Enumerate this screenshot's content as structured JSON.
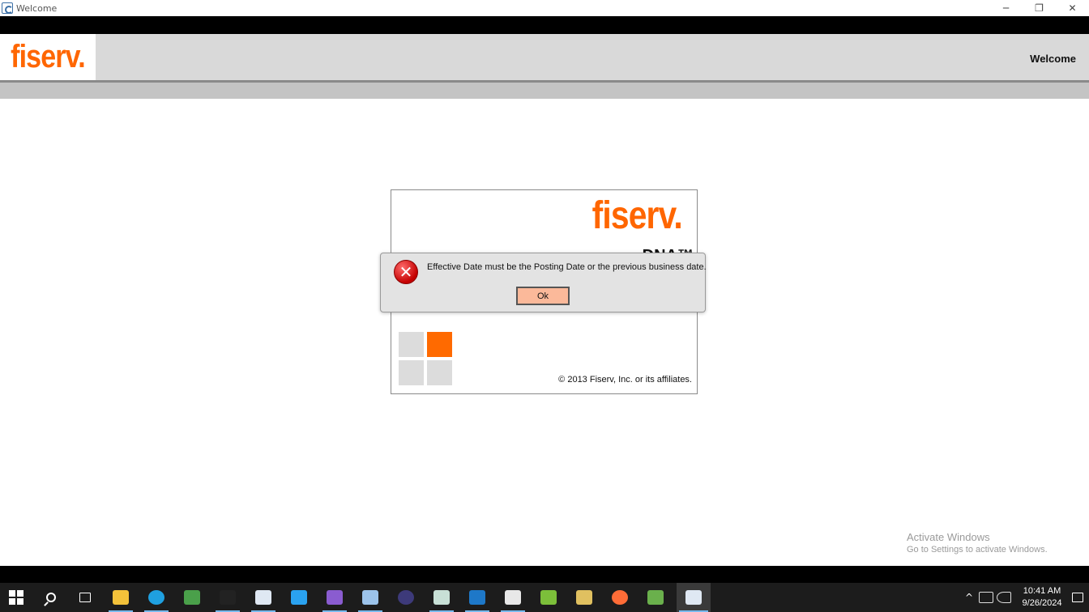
{
  "window": {
    "title": "Welcome",
    "controls": {
      "minimize": "─",
      "restore": "❐",
      "close": "✕"
    }
  },
  "header": {
    "logo": "fiserv.",
    "title": "Welcome"
  },
  "splash": {
    "logo": "fiserv.",
    "product": "DNA™",
    "copyright": "© 2013 Fiserv, Inc. or its affiliates.",
    "brand_color": "#ff6600"
  },
  "dialog": {
    "message": "Effective Date must be the Posting Date or the previous business date.",
    "ok_label": "Ok",
    "icon": "error-icon"
  },
  "watermark": {
    "line1": "Activate Windows",
    "line2": "Go to Settings to activate Windows."
  },
  "taskbar": {
    "apps": [
      {
        "name": "start-icon"
      },
      {
        "name": "search-icon"
      },
      {
        "name": "task-view-icon"
      },
      {
        "name": "file-explorer-icon",
        "color": "#f3c13a"
      },
      {
        "name": "edge-icon",
        "color": "#1fa0e0"
      },
      {
        "name": "media-app-icon",
        "color": "#4aa04a"
      },
      {
        "name": "terminal-icon",
        "color": "#222222"
      },
      {
        "name": "dna-app-icon",
        "color": "#dfe8f3"
      },
      {
        "name": "vscode-icon",
        "color": "#2aa2f0"
      },
      {
        "name": "visual-studio-icon",
        "color": "#8a5cd0"
      },
      {
        "name": "document-app-icon",
        "color": "#9cc3ea"
      },
      {
        "name": "eclipse-icon",
        "color": "#3d3a7a"
      },
      {
        "name": "notepad-app-icon",
        "color": "#c8e0d6"
      },
      {
        "name": "window-app-icon",
        "color": "#1e78c8"
      },
      {
        "name": "paint-app-icon",
        "color": "#e8e8e8"
      },
      {
        "name": "chart-doc-icon",
        "color": "#7cbf3a"
      },
      {
        "name": "files-app-icon",
        "color": "#e0c060"
      },
      {
        "name": "postman-icon",
        "color": "#ff6c37"
      },
      {
        "name": "player-app-icon",
        "color": "#6ab04c"
      },
      {
        "name": "dna-app-active-icon",
        "color": "#dfe8f3"
      }
    ],
    "tray": {
      "chevron": "^",
      "time": "10:41 AM",
      "date": "9/26/2024"
    }
  }
}
